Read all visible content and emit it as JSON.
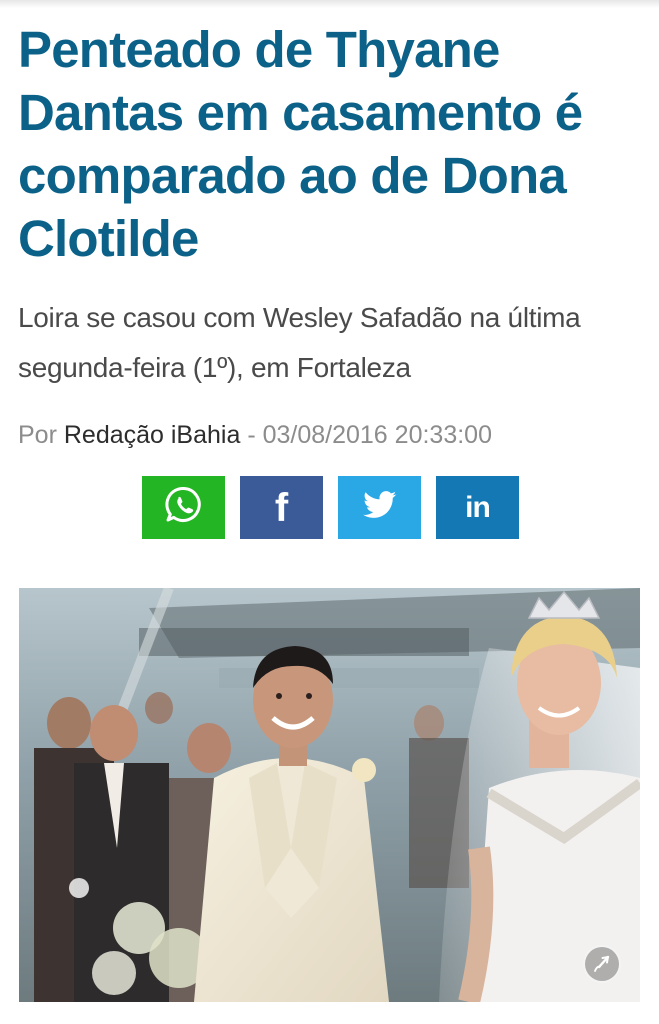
{
  "article": {
    "headline": "Penteado de Thyane Dantas em casamento é comparado ao de Dona Clotilde",
    "subtitle": "Loira se casou com Wesley Safadão na última segunda-feira (1º), em Fortaleza",
    "byline": {
      "prefix": "Por ",
      "author": "Redação iBahia",
      "separator": " - ",
      "datetime": "03/08/2016 20:33:00"
    }
  },
  "share": [
    {
      "network": "WhatsApp",
      "icon": "whatsapp-icon",
      "color": "#24b524"
    },
    {
      "network": "Facebook",
      "icon": "facebook-icon",
      "glyph": "f",
      "color": "#3a5a98"
    },
    {
      "network": "Twitter",
      "icon": "twitter-icon",
      "color": "#2aa8e6"
    },
    {
      "network": "LinkedIn",
      "icon": "linkedin-icon",
      "glyph": "in",
      "color": "#1378b3"
    }
  ],
  "photo": {
    "subject": "wedding photo of groom in white suit and bride in white dress with tiara",
    "expand_icon": "expand-icon"
  },
  "colors": {
    "headline": "#0b6188",
    "subtitle": "#4a4a4a",
    "byline_meta": "#8c8c8c",
    "byline_author": "#2d2d2d"
  }
}
